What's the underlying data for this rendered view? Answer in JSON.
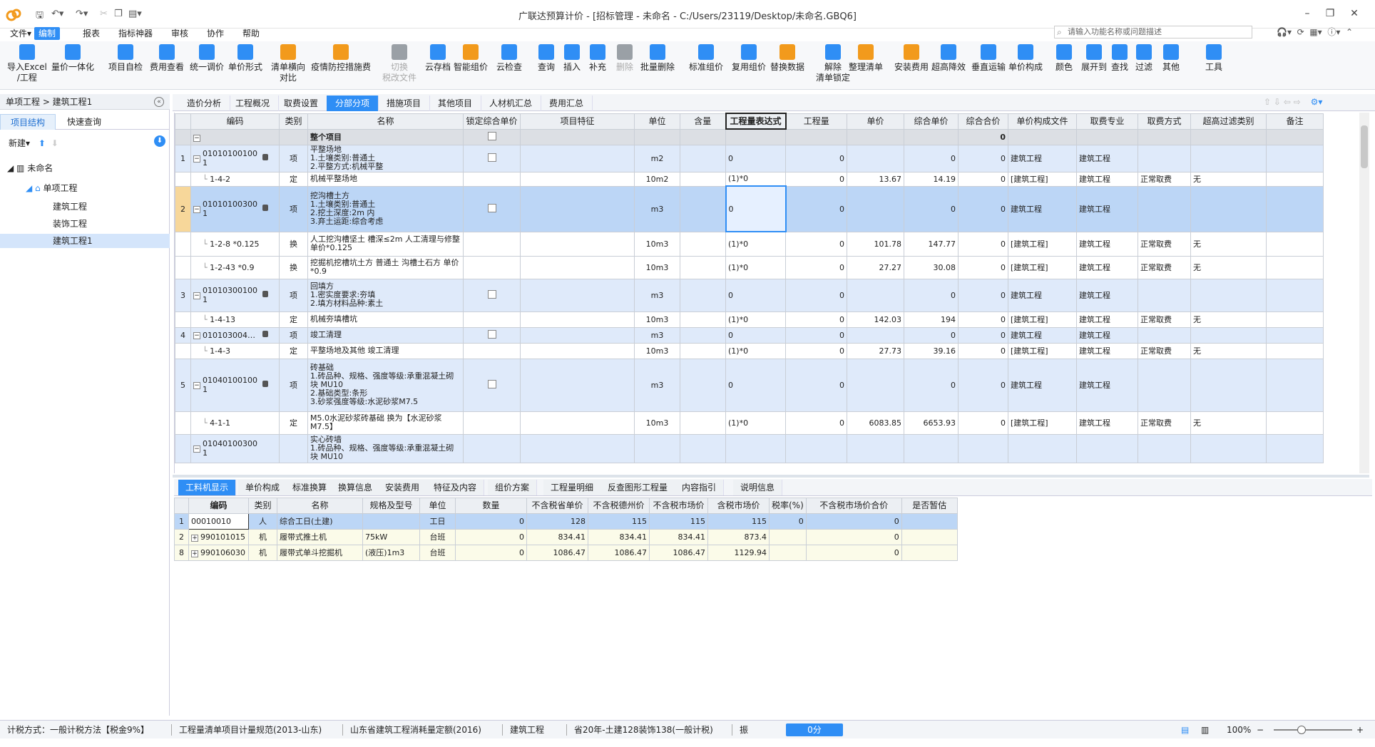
{
  "window": {
    "title": "广联达预算计价 - [招标管理 - 未命名 - C:/Users/23119/Desktop/未命名.GBQ6]",
    "minimize": "–",
    "restore": "❐",
    "close": "✕"
  },
  "menu": {
    "items": [
      "文件▾",
      "编制",
      "报表",
      "指标神器",
      "审核",
      "协作",
      "帮助"
    ],
    "active_index": 1
  },
  "search": {
    "placeholder": "请输入功能名称或问题描述"
  },
  "ribbon": {
    "buttons": [
      {
        "label": "导入Excel\n/工程",
        "icon": "import-excel-icon",
        "color": "b"
      },
      {
        "label": "量价一体化",
        "icon": "integration-icon",
        "color": "b"
      },
      {
        "label": "项目自检",
        "icon": "self-check-icon",
        "color": "b"
      },
      {
        "label": "费用查看",
        "icon": "fee-view-icon",
        "color": "b"
      },
      {
        "label": "统一调价",
        "icon": "adjust-price-icon",
        "color": "b"
      },
      {
        "label": "单价形式",
        "icon": "unit-price-icon",
        "color": "b"
      },
      {
        "label": "清单横向\n对比",
        "icon": "compare-icon",
        "color": "o"
      },
      {
        "label": "疫情防控措施费",
        "icon": "epidemic-fee-icon",
        "color": "o"
      },
      {
        "label": "切换\n税改文件",
        "icon": "tax-switch-icon",
        "color": "g",
        "disabled": true
      },
      {
        "label": "云存档",
        "icon": "cloud-save-icon",
        "color": "b"
      },
      {
        "label": "智能组价",
        "icon": "smart-price-icon",
        "color": "o"
      },
      {
        "label": "云检查",
        "icon": "cloud-check-icon",
        "color": "b"
      },
      {
        "label": "查询",
        "icon": "query-icon",
        "color": "b"
      },
      {
        "label": "插入",
        "icon": "insert-icon",
        "color": "b"
      },
      {
        "label": "补充",
        "icon": "supplement-icon",
        "color": "b"
      },
      {
        "label": "删除",
        "icon": "delete-icon",
        "color": "g",
        "disabled": true
      },
      {
        "label": "批量删除",
        "icon": "batch-delete-icon",
        "color": "b"
      },
      {
        "label": "标准组价",
        "icon": "standard-price-icon",
        "color": "b"
      },
      {
        "label": "复用组价",
        "icon": "reuse-price-icon",
        "color": "b"
      },
      {
        "label": "替换数据",
        "icon": "replace-data-icon",
        "color": "o"
      },
      {
        "label": "解除\n清单锁定",
        "icon": "unlock-icon",
        "color": "b"
      },
      {
        "label": "整理清单",
        "icon": "organize-icon",
        "color": "o"
      },
      {
        "label": "安装费用",
        "icon": "install-fee-icon",
        "color": "o"
      },
      {
        "label": "超高降效",
        "icon": "high-rise-icon",
        "color": "b"
      },
      {
        "label": "垂直运输",
        "icon": "vertical-transport-icon",
        "color": "b"
      },
      {
        "label": "单价构成",
        "icon": "price-structure-icon",
        "color": "b"
      },
      {
        "label": "颜色",
        "icon": "color-icon",
        "color": "b"
      },
      {
        "label": "展开到",
        "icon": "expand-icon",
        "color": "b"
      },
      {
        "label": "查找",
        "icon": "find-icon",
        "color": "b"
      },
      {
        "label": "过滤",
        "icon": "filter-icon",
        "color": "b"
      },
      {
        "label": "其他",
        "icon": "other-icon",
        "color": "b"
      },
      {
        "label": "工具",
        "icon": "tools-icon",
        "color": "b"
      }
    ]
  },
  "left": {
    "breadcrumb": "单项工程 > 建筑工程1",
    "tabs": [
      "项目结构",
      "快速查询"
    ],
    "new_label": "新建▾",
    "tree": [
      {
        "label": "未命名",
        "level": 0
      },
      {
        "label": "单项工程",
        "level": 1
      },
      {
        "label": "建筑工程",
        "level": 2
      },
      {
        "label": "装饰工程",
        "level": 2
      },
      {
        "label": "建筑工程1",
        "level": 2,
        "selected": true
      }
    ]
  },
  "main_tabs": [
    "造价分析",
    "工程概况",
    "取费设置",
    "分部分项",
    "措施项目",
    "其他项目",
    "人材机汇总",
    "费用汇总"
  ],
  "main_tab_active": 3,
  "grid": {
    "headers": [
      "",
      "编码",
      "类别",
      "名称",
      "锁定综合单价",
      "项目特征",
      "单位",
      "含量",
      "工程量表达式",
      "工程量",
      "单价",
      "综合单价",
      "综合合价",
      "单价构成文件",
      "取费专业",
      "取费方式",
      "超高过滤类别",
      "备注"
    ],
    "whole_row": {
      "name": "整个项目",
      "total": "0"
    },
    "rows": [
      {
        "type": "item",
        "no": "1",
        "code": "010101001001",
        "cat": "项",
        "name": "平整场地\n1.土壤类别:普通土\n2.平整方式:机械平整",
        "unit": "m2",
        "expr": "0",
        "qty": "0",
        "price": "",
        "comp": "0",
        "total": "0",
        "file": "建筑工程",
        "spec": "建筑工程",
        "mode": "",
        "filt": "",
        "h": 38
      },
      {
        "type": "quota",
        "no": "",
        "code": "1-4-2",
        "cat": "定",
        "name": "机械平整场地",
        "unit": "10m2",
        "expr": "(1)*0",
        "qty": "0",
        "price": "13.67",
        "comp": "14.19",
        "total": "0",
        "file": "[建筑工程]",
        "spec": "建筑工程",
        "mode": "正常取费",
        "filt": "无",
        "h": 20
      },
      {
        "type": "item sel",
        "no": "2",
        "code": "010101003001",
        "cat": "项",
        "name": "挖沟槽土方\n1.土壤类别:普通土\n2.挖土深度:2m 内\n3.弃土运距:综合考虑",
        "unit": "m3",
        "expr": "0",
        "qty": "0",
        "price": "",
        "comp": "0",
        "total": "0",
        "file": "建筑工程",
        "spec": "建筑工程",
        "mode": "",
        "filt": "",
        "h": 64
      },
      {
        "type": "quota",
        "no": "",
        "code": "1-2-8 *0.125",
        "cat": "换",
        "name": "人工挖沟槽坚土 槽深≤2m 人工清理与修整 单价*0.125",
        "unit": "10m3",
        "expr": "(1)*0",
        "qty": "0",
        "price": "101.78",
        "comp": "147.77",
        "total": "0",
        "file": "[建筑工程]",
        "spec": "建筑工程",
        "mode": "正常取费",
        "filt": "无",
        "h": 34
      },
      {
        "type": "quota",
        "no": "",
        "code": "1-2-43 *0.9",
        "cat": "换",
        "name": "挖掘机挖槽坑土方 普通土 沟槽土石方 单价*0.9",
        "unit": "10m3",
        "expr": "(1)*0",
        "qty": "0",
        "price": "27.27",
        "comp": "30.08",
        "total": "0",
        "file": "[建筑工程]",
        "spec": "建筑工程",
        "mode": "正常取费",
        "filt": "无",
        "h": 32
      },
      {
        "type": "item",
        "no": "3",
        "code": "010103001001",
        "cat": "项",
        "name": "回填方\n1.密实度要求:夯填\n2.填方材料品种:素土",
        "unit": "m3",
        "expr": "0",
        "qty": "0",
        "price": "",
        "comp": "0",
        "total": "0",
        "file": "建筑工程",
        "spec": "建筑工程",
        "mode": "",
        "filt": "",
        "h": 46
      },
      {
        "type": "quota",
        "no": "",
        "code": "1-4-13",
        "cat": "定",
        "name": "机械夯填槽坑",
        "unit": "10m3",
        "expr": "(1)*0",
        "qty": "0",
        "price": "142.03",
        "comp": "194",
        "total": "0",
        "file": "[建筑工程]",
        "spec": "建筑工程",
        "mode": "正常取费",
        "filt": "无",
        "h": 22
      },
      {
        "type": "item",
        "no": "4",
        "code": "010103004…",
        "cat": "项",
        "name": "竣工清理",
        "unit": "m3",
        "expr": "0",
        "qty": "0",
        "price": "",
        "comp": "0",
        "total": "0",
        "file": "建筑工程",
        "spec": "建筑工程",
        "mode": "",
        "filt": "",
        "h": 22
      },
      {
        "type": "quota",
        "no": "",
        "code": "1-4-3",
        "cat": "定",
        "name": "平整场地及其他 竣工清理",
        "unit": "10m3",
        "expr": "(1)*0",
        "qty": "0",
        "price": "27.73",
        "comp": "39.16",
        "total": "0",
        "file": "[建筑工程]",
        "spec": "建筑工程",
        "mode": "正常取费",
        "filt": "无",
        "h": 22
      },
      {
        "type": "item",
        "no": "5",
        "code": "010401001001",
        "cat": "项",
        "name": "砖基础\n1.砖品种、规格、强度等级:承重混凝土砌块 MU10\n2.基础类型:条形\n3.砂浆强度等级:水泥砂浆M7.5",
        "unit": "m3",
        "expr": "0",
        "qty": "0",
        "price": "",
        "comp": "0",
        "total": "0",
        "file": "建筑工程",
        "spec": "建筑工程",
        "mode": "",
        "filt": "",
        "h": 74
      },
      {
        "type": "quota",
        "no": "",
        "code": "4-1-1",
        "cat": "定",
        "name": "M5.0水泥砂浆砖基础 换为【水泥砂浆 M7.5】",
        "unit": "10m3",
        "expr": "(1)*0",
        "qty": "0",
        "price": "6083.85",
        "comp": "6653.93",
        "total": "0",
        "file": "[建筑工程]",
        "spec": "建筑工程",
        "mode": "正常取费",
        "filt": "无",
        "h": 32
      },
      {
        "type": "item",
        "no": "",
        "code": "010401003001",
        "cat": "",
        "name": "实心砖墙\n1.砖品种、规格、强度等级:承重混凝土砌块 MU10",
        "unit": "",
        "expr": "",
        "qty": "",
        "price": "",
        "comp": "",
        "total": "",
        "file": "",
        "spec": "",
        "mode": "",
        "filt": "",
        "h": 40
      }
    ]
  },
  "bottom_tabs": [
    "工料机显示",
    "单价构成",
    "标准换算",
    "换算信息",
    "安装费用",
    "特征及内容",
    "组价方案",
    "工程量明细",
    "反查图形工程量",
    "内容指引",
    "说明信息"
  ],
  "bottom_tab_active": 0,
  "grid2": {
    "headers": [
      "",
      "编码",
      "类别",
      "名称",
      "规格及型号",
      "单位",
      "数量",
      "不含税省单价",
      "不含税德州价",
      "不含税市场价",
      "含税市场价",
      "税率(%)",
      "不含税市场价合价",
      "是否暂估"
    ],
    "rows": [
      {
        "no": "1",
        "code": "00010010",
        "cat": "人",
        "name": "综合工日(土建)",
        "spec": "",
        "unit": "工日",
        "qty": "0",
        "p1": "128",
        "p2": "115",
        "p3": "115",
        "p4": "115",
        "tax": "0",
        "sum": "0",
        "est": "",
        "sel": true,
        "exp": false
      },
      {
        "no": "2",
        "code": "990101015",
        "cat": "机",
        "name": "履带式推土机",
        "spec": "75kW",
        "unit": "台班",
        "qty": "0",
        "p1": "834.41",
        "p2": "834.41",
        "p3": "834.41",
        "p4": "873.4",
        "tax": "",
        "sum": "0",
        "est": "",
        "sel": false,
        "exp": true
      },
      {
        "no": "8",
        "code": "990106030",
        "cat": "机",
        "name": "履带式单斗挖掘机",
        "spec": "(液压)1m3",
        "unit": "台班",
        "qty": "0",
        "p1": "1086.47",
        "p2": "1086.47",
        "p3": "1086.47",
        "p4": "1129.94",
        "tax": "",
        "sum": "0",
        "est": "",
        "sel": false,
        "exp": true
      }
    ]
  },
  "status": {
    "tax_method": "计税方式：一般计税方法【税金9%】",
    "spec1": "工程量清单项目计量规范(2013-山东)",
    "spec2": "山东省建筑工程消耗量定额(2016)",
    "major": "建筑工程",
    "province": "省20年-土建128装饰138(一般计税)",
    "zhen": "振",
    "score": "0分",
    "zoom": "100%",
    "zoom_fraction": 0.35
  }
}
